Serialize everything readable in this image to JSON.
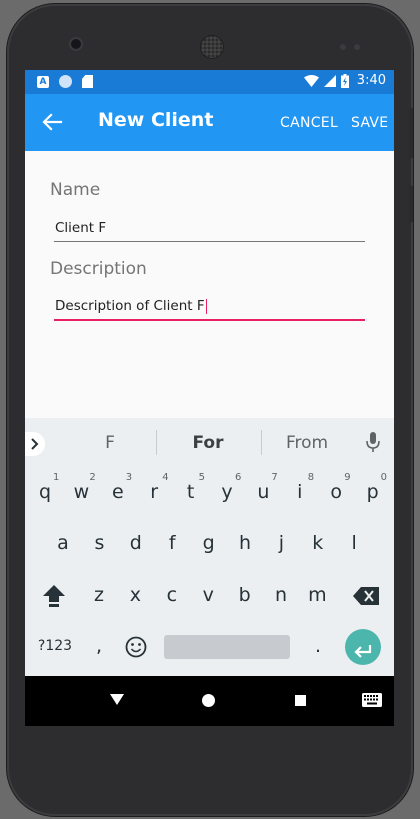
{
  "status_bar": {
    "notif_a": "A",
    "time": "3:40"
  },
  "app_bar": {
    "title": "New Client",
    "cancel_label": "CANCEL",
    "save_label": "SAVE"
  },
  "form": {
    "name_label": "Name",
    "name_value": "Client F",
    "description_label": "Description",
    "description_value": "Description of Client F"
  },
  "keyboard": {
    "suggestions": [
      "F",
      "For",
      "From"
    ],
    "row1": [
      {
        "k": "q",
        "h": "1"
      },
      {
        "k": "w",
        "h": "2"
      },
      {
        "k": "e",
        "h": "3"
      },
      {
        "k": "r",
        "h": "4"
      },
      {
        "k": "t",
        "h": "5"
      },
      {
        "k": "y",
        "h": "6"
      },
      {
        "k": "u",
        "h": "7"
      },
      {
        "k": "i",
        "h": "8"
      },
      {
        "k": "o",
        "h": "9"
      },
      {
        "k": "p",
        "h": "0"
      }
    ],
    "row2": [
      "a",
      "s",
      "d",
      "f",
      "g",
      "h",
      "j",
      "k",
      "l"
    ],
    "row3": [
      "z",
      "x",
      "c",
      "v",
      "b",
      "n",
      "m"
    ],
    "symbols_label": "?123",
    "comma_label": ",",
    "period_label": "."
  },
  "colors": {
    "status_bar": "#1a7bd7",
    "app_bar": "#2196f3",
    "focus_underline": "#e91e63",
    "enter_key": "#4db6ac"
  },
  "icons": {
    "back": "arrow-left-icon",
    "mic": "mic-icon",
    "shift": "shift-icon",
    "backspace": "backspace-icon",
    "emoji": "emoji-icon",
    "enter": "enter-icon"
  }
}
